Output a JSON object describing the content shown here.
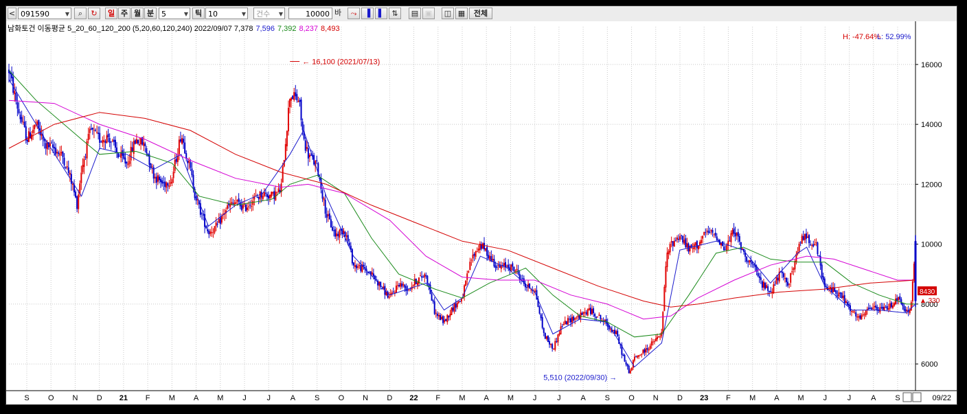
{
  "toolbar": {
    "nav_prev": "<",
    "code": "091590",
    "search_icon": "magnifier-icon",
    "refresh_icon": "refresh-icon",
    "tabs": [
      "일",
      "주",
      "월",
      "분"
    ],
    "period_value": "5",
    "tick_label": "틱",
    "tick_value": "10",
    "count_mode": "건수",
    "count_value": "10000",
    "count_unit": "바",
    "all_button": "전체"
  },
  "header": {
    "indicator_text": "남화토건 이동평균 5_20_60_120_200  (5,20,60,120,240) 2022/09/07 7,378",
    "ma5": "7,596",
    "ma20": "7,392",
    "ma60": "8,237",
    "ma120": "8,493",
    "high_pct": "H: -47.64%",
    "low_pct": "L: 52.99%",
    "colors": {
      "ma5": "#1a1acc",
      "ma20": "#1a8a1a",
      "ma60": "#d400d4",
      "ma120": "#d40000"
    }
  },
  "chart_data": {
    "type": "candlestick",
    "y_ticks": [
      6000,
      8000,
      10000,
      12000,
      14000,
      16000
    ],
    "ylim": [
      5200,
      16800
    ],
    "x_labels": [
      "S",
      "O",
      "N",
      "D",
      "21",
      "F",
      "M",
      "A",
      "M",
      "J",
      "J",
      "A",
      "S",
      "O",
      "N",
      "D",
      "22",
      "F",
      "M",
      "A",
      "M",
      "J",
      "J",
      "A",
      "S",
      "O",
      "N",
      "D",
      "23",
      "F",
      "M",
      "A",
      "M",
      "J",
      "J",
      "A",
      "S"
    ],
    "x_end_label": "09/22",
    "annotations": [
      {
        "text": "16,100 (2021/07/13)",
        "value": 16100
      },
      {
        "text": "5,510 (2022/09/30)",
        "value": 5510
      }
    ],
    "current_price": "8430",
    "change": "▲ 330",
    "price_path": [
      [
        0,
        15800
      ],
      [
        0.01,
        14500
      ],
      [
        0.02,
        13500
      ],
      [
        0.03,
        14000
      ],
      [
        0.04,
        13300
      ],
      [
        0.05,
        13200
      ],
      [
        0.06,
        12900
      ],
      [
        0.07,
        12000
      ],
      [
        0.075,
        11300
      ],
      [
        0.08,
        12500
      ],
      [
        0.09,
        13800
      ],
      [
        0.1,
        13500
      ],
      [
        0.11,
        13600
      ],
      [
        0.12,
        13000
      ],
      [
        0.13,
        12700
      ],
      [
        0.14,
        13500
      ],
      [
        0.15,
        13300
      ],
      [
        0.16,
        12300
      ],
      [
        0.17,
        12000
      ],
      [
        0.18,
        12200
      ],
      [
        0.19,
        13700
      ],
      [
        0.2,
        12500
      ],
      [
        0.205,
        11700
      ],
      [
        0.21,
        11200
      ],
      [
        0.22,
        10400
      ],
      [
        0.23,
        10600
      ],
      [
        0.24,
        11200
      ],
      [
        0.25,
        11400
      ],
      [
        0.26,
        11200
      ],
      [
        0.27,
        11500
      ],
      [
        0.28,
        11700
      ],
      [
        0.29,
        11600
      ],
      [
        0.3,
        11800
      ],
      [
        0.31,
        15000
      ],
      [
        0.32,
        14800
      ],
      [
        0.325,
        13500
      ],
      [
        0.33,
        13000
      ],
      [
        0.34,
        12600
      ],
      [
        0.35,
        11000
      ],
      [
        0.36,
        10300
      ],
      [
        0.37,
        10500
      ],
      [
        0.375,
        10000
      ],
      [
        0.38,
        9300
      ],
      [
        0.39,
        9200
      ],
      [
        0.4,
        9000
      ],
      [
        0.41,
        8600
      ],
      [
        0.42,
        8200
      ],
      [
        0.43,
        8700
      ],
      [
        0.44,
        8500
      ],
      [
        0.45,
        8800
      ],
      [
        0.46,
        9000
      ],
      [
        0.47,
        7700
      ],
      [
        0.48,
        7400
      ],
      [
        0.49,
        7900
      ],
      [
        0.5,
        8200
      ],
      [
        0.51,
        9500
      ],
      [
        0.52,
        10000
      ],
      [
        0.53,
        9600
      ],
      [
        0.54,
        9200
      ],
      [
        0.55,
        9300
      ],
      [
        0.56,
        9100
      ],
      [
        0.57,
        8600
      ],
      [
        0.58,
        8500
      ],
      [
        0.59,
        7000
      ],
      [
        0.6,
        6500
      ],
      [
        0.61,
        7300
      ],
      [
        0.62,
        7500
      ],
      [
        0.63,
        7600
      ],
      [
        0.64,
        7800
      ],
      [
        0.65,
        7600
      ],
      [
        0.66,
        7300
      ],
      [
        0.67,
        7000
      ],
      [
        0.68,
        6000
      ],
      [
        0.685,
        5700
      ],
      [
        0.69,
        6200
      ],
      [
        0.7,
        6400
      ],
      [
        0.71,
        6700
      ],
      [
        0.72,
        7000
      ],
      [
        0.725,
        9500
      ],
      [
        0.73,
        10000
      ],
      [
        0.74,
        10300
      ],
      [
        0.75,
        9800
      ],
      [
        0.76,
        10000
      ],
      [
        0.77,
        10400
      ],
      [
        0.78,
        10300
      ],
      [
        0.79,
        9800
      ],
      [
        0.8,
        10500
      ],
      [
        0.81,
        9700
      ],
      [
        0.82,
        9300
      ],
      [
        0.83,
        8700
      ],
      [
        0.84,
        8400
      ],
      [
        0.85,
        9000
      ],
      [
        0.86,
        8700
      ],
      [
        0.87,
        9700
      ],
      [
        0.875,
        10300
      ],
      [
        0.88,
        10200
      ],
      [
        0.89,
        10000
      ],
      [
        0.9,
        8500
      ],
      [
        0.91,
        8500
      ],
      [
        0.92,
        8200
      ],
      [
        0.93,
        7700
      ],
      [
        0.94,
        7500
      ],
      [
        0.95,
        7900
      ],
      [
        0.96,
        7800
      ],
      [
        0.97,
        7900
      ],
      [
        0.98,
        8200
      ],
      [
        0.99,
        7700
      ],
      [
        0.995,
        7900
      ],
      [
        1,
        10100
      ]
    ],
    "ma_series": [
      {
        "name": "ma5",
        "color": "#1a1acc",
        "points": [
          [
            0,
            15500
          ],
          [
            0.04,
            13500
          ],
          [
            0.08,
            11600
          ],
          [
            0.1,
            13200
          ],
          [
            0.13,
            13000
          ],
          [
            0.16,
            12500
          ],
          [
            0.19,
            13000
          ],
          [
            0.22,
            10600
          ],
          [
            0.25,
            11300
          ],
          [
            0.28,
            11700
          ],
          [
            0.31,
            13000
          ],
          [
            0.325,
            13800
          ],
          [
            0.35,
            11600
          ],
          [
            0.38,
            9600
          ],
          [
            0.42,
            8300
          ],
          [
            0.46,
            8700
          ],
          [
            0.48,
            7800
          ],
          [
            0.5,
            8200
          ],
          [
            0.52,
            9600
          ],
          [
            0.55,
            9200
          ],
          [
            0.58,
            8400
          ],
          [
            0.6,
            7000
          ],
          [
            0.63,
            7500
          ],
          [
            0.66,
            7400
          ],
          [
            0.69,
            5900
          ],
          [
            0.72,
            6700
          ],
          [
            0.74,
            9800
          ],
          [
            0.78,
            10100
          ],
          [
            0.81,
            9800
          ],
          [
            0.84,
            8700
          ],
          [
            0.87,
            9700
          ],
          [
            0.88,
            9900
          ],
          [
            0.9,
            8600
          ],
          [
            0.93,
            7800
          ],
          [
            0.96,
            7800
          ],
          [
            0.99,
            7700
          ],
          [
            1,
            8000
          ]
        ]
      },
      {
        "name": "ma20",
        "color": "#1a8a1a",
        "points": [
          [
            0,
            15800
          ],
          [
            0.03,
            14800
          ],
          [
            0.08,
            13500
          ],
          [
            0.1,
            13000
          ],
          [
            0.14,
            13100
          ],
          [
            0.18,
            12700
          ],
          [
            0.21,
            11600
          ],
          [
            0.25,
            11300
          ],
          [
            0.29,
            11500
          ],
          [
            0.31,
            12000
          ],
          [
            0.34,
            12300
          ],
          [
            0.37,
            11700
          ],
          [
            0.4,
            10200
          ],
          [
            0.43,
            9000
          ],
          [
            0.47,
            8500
          ],
          [
            0.5,
            8200
          ],
          [
            0.53,
            8700
          ],
          [
            0.57,
            9200
          ],
          [
            0.6,
            8300
          ],
          [
            0.63,
            7600
          ],
          [
            0.66,
            7400
          ],
          [
            0.69,
            6900
          ],
          [
            0.72,
            7000
          ],
          [
            0.75,
            8300
          ],
          [
            0.78,
            9700
          ],
          [
            0.81,
            9900
          ],
          [
            0.84,
            9500
          ],
          [
            0.87,
            9400
          ],
          [
            0.9,
            9400
          ],
          [
            0.93,
            8700
          ],
          [
            0.96,
            8300
          ],
          [
            0.99,
            8000
          ],
          [
            1,
            8000
          ]
        ]
      },
      {
        "name": "ma60",
        "color": "#d400d4",
        "points": [
          [
            0,
            14800
          ],
          [
            0.05,
            14700
          ],
          [
            0.1,
            14000
          ],
          [
            0.15,
            13500
          ],
          [
            0.2,
            12800
          ],
          [
            0.25,
            12200
          ],
          [
            0.3,
            11900
          ],
          [
            0.33,
            12000
          ],
          [
            0.37,
            11700
          ],
          [
            0.42,
            10800
          ],
          [
            0.46,
            9600
          ],
          [
            0.5,
            8900
          ],
          [
            0.54,
            8800
          ],
          [
            0.58,
            8800
          ],
          [
            0.62,
            8300
          ],
          [
            0.66,
            8000
          ],
          [
            0.7,
            7500
          ],
          [
            0.73,
            7600
          ],
          [
            0.76,
            8200
          ],
          [
            0.8,
            8800
          ],
          [
            0.84,
            9300
          ],
          [
            0.88,
            9600
          ],
          [
            0.91,
            9500
          ],
          [
            0.95,
            9100
          ],
          [
            0.98,
            8800
          ],
          [
            1,
            8800
          ]
        ]
      },
      {
        "name": "ma120",
        "color": "#d40000",
        "points": [
          [
            0,
            13200
          ],
          [
            0.05,
            14000
          ],
          [
            0.1,
            14400
          ],
          [
            0.15,
            14200
          ],
          [
            0.2,
            13800
          ],
          [
            0.25,
            13000
          ],
          [
            0.3,
            12400
          ],
          [
            0.35,
            12000
          ],
          [
            0.4,
            11300
          ],
          [
            0.45,
            10700
          ],
          [
            0.5,
            10100
          ],
          [
            0.55,
            9800
          ],
          [
            0.6,
            9200
          ],
          [
            0.65,
            8600
          ],
          [
            0.7,
            8100
          ],
          [
            0.73,
            7900
          ],
          [
            0.76,
            8000
          ],
          [
            0.8,
            8200
          ],
          [
            0.85,
            8400
          ],
          [
            0.9,
            8500
          ],
          [
            0.95,
            8700
          ],
          [
            1,
            8800
          ]
        ]
      }
    ]
  }
}
